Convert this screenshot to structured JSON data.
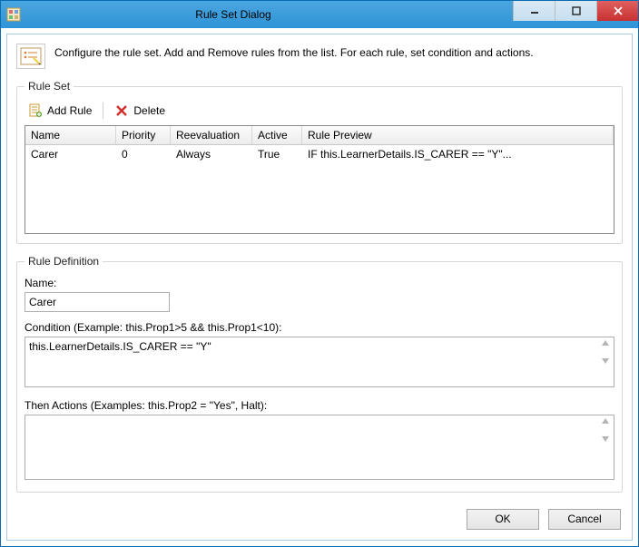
{
  "titlebar": {
    "title": "Rule Set Dialog"
  },
  "config": {
    "text": "Configure the rule set. Add and Remove rules from the list. For each rule, set condition and actions."
  },
  "ruleSet": {
    "legend": "Rule Set",
    "addRule": "Add Rule",
    "delete": "Delete",
    "columns": {
      "name": "Name",
      "priority": "Priority",
      "reevaluation": "Reevaluation",
      "active": "Active",
      "preview": "Rule Preview"
    },
    "rows": [
      {
        "name": "Carer",
        "priority": "0",
        "reevaluation": "Always",
        "active": "True",
        "preview": "IF this.LearnerDetails.IS_CARER == \"Y\"..."
      }
    ]
  },
  "ruleDef": {
    "legend": "Rule Definition",
    "nameLabel": "Name:",
    "nameValue": "Carer",
    "conditionLabel": "Condition (Example: this.Prop1>5 && this.Prop1<10):",
    "conditionValue": "this.LearnerDetails.IS_CARER == \"Y\"",
    "thenLabel": "Then Actions (Examples: this.Prop2 = \"Yes\", Halt):",
    "thenValue": ""
  },
  "footer": {
    "ok": "OK",
    "cancel": "Cancel"
  }
}
